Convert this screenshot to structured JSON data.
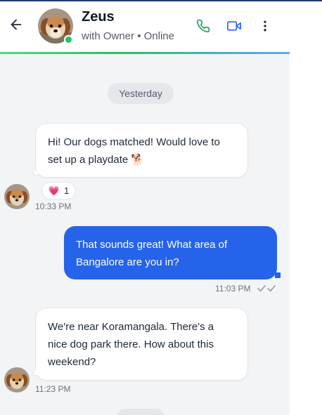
{
  "header": {
    "name": "Zeus",
    "status": "with Owner • Online",
    "back_icon": "arrow-left-icon",
    "call_icon": "phone-icon",
    "video_icon": "video-icon",
    "menu_icon": "more-vertical-icon",
    "accent_call": "#22a35a",
    "accent_video": "#2563eb"
  },
  "chat": {
    "date_divider": "Yesterday",
    "messages": [
      {
        "direction": "incoming",
        "lines": [
          "Hi! Our dogs matched! Would love to",
          "set up a playdate 🐕"
        ],
        "reaction_emoji": "💗",
        "reaction_count": "1",
        "time": "10:33 PM"
      },
      {
        "direction": "outgoing",
        "lines": [
          "That sounds great! What area of",
          "Bangalore are you in?"
        ],
        "time": "11:03 PM",
        "read_icon": "double-check-icon"
      },
      {
        "direction": "incoming",
        "lines": [
          "We're near Koramangala. There's a",
          "nice dog park there. How about this",
          "weekend?"
        ],
        "time": "11:23 PM"
      }
    ]
  },
  "colors": {
    "outgoing_bubble": "#2563eb",
    "incoming_bubble": "#ffffff",
    "background": "#f3f4f6",
    "online": "#22c55e"
  }
}
